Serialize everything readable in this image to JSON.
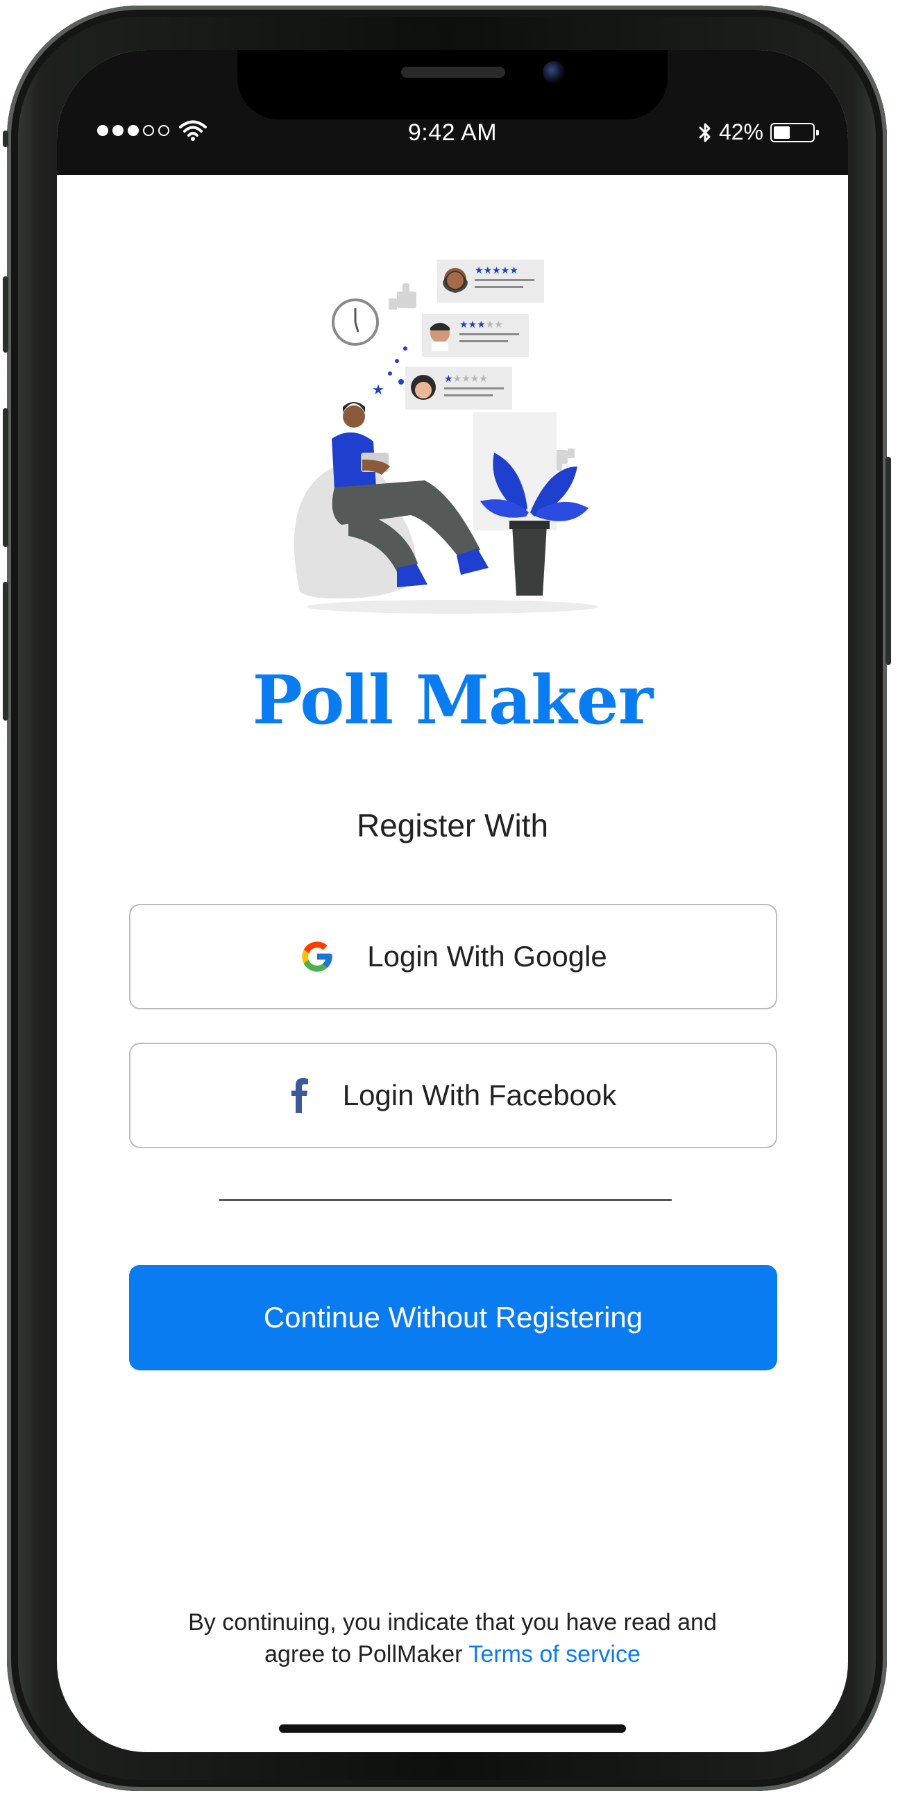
{
  "status_bar": {
    "time": "9:42 AM",
    "battery_percent": "42%",
    "battery_level": 0.42,
    "signal_bars_filled": 3,
    "signal_bars_total": 5
  },
  "app": {
    "title": "Poll Maker",
    "subtitle": "Register With"
  },
  "buttons": {
    "google_label": "Login With Google",
    "facebook_label": "Login With Facebook",
    "continue_label": "Continue Without Registering"
  },
  "footer": {
    "text_line1": "By continuing, you indicate that you have read and",
    "text_line2": "agree to PollMaker",
    "terms_link": "Terms of service"
  },
  "icons": {
    "google": "google-icon",
    "facebook": "facebook-icon",
    "wifi": "wifi-icon",
    "bluetooth": "bluetooth-icon",
    "battery": "battery-icon"
  },
  "colors": {
    "accent": "#0a7cf2",
    "facebook_blue": "#3b5998",
    "status_bar_bg": "#111111"
  }
}
